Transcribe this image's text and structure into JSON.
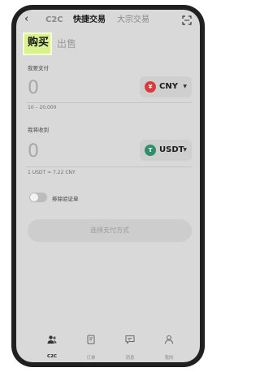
{
  "nav": {
    "back_icon": "‹",
    "tabs": [
      "C2C",
      "快捷交易",
      "大宗交易"
    ],
    "scan_icon": "scan-icon"
  },
  "mode": {
    "buy": "购买",
    "sell": "出售"
  },
  "pay": {
    "label": "我要支付",
    "value": "0",
    "currency": "CNY",
    "currency_symbol": "¥",
    "currency_color": "#d83b3b",
    "range": "10 – 20,000"
  },
  "receive": {
    "label": "我将收到",
    "value": "0",
    "currency": "USDT",
    "currency_symbol": "T",
    "currency_color": "#2f8f6a",
    "rate": "1 USDT ≈ 7.22 CNY"
  },
  "option": {
    "label": "排除验证单"
  },
  "cta": {
    "label": "选择支付方式"
  },
  "bottom_nav": [
    {
      "label": "C2C",
      "icon": "users-icon"
    },
    {
      "label": "订单",
      "icon": "order-icon"
    },
    {
      "label": "消息",
      "icon": "message-icon"
    },
    {
      "label": "我的",
      "icon": "profile-icon"
    }
  ]
}
